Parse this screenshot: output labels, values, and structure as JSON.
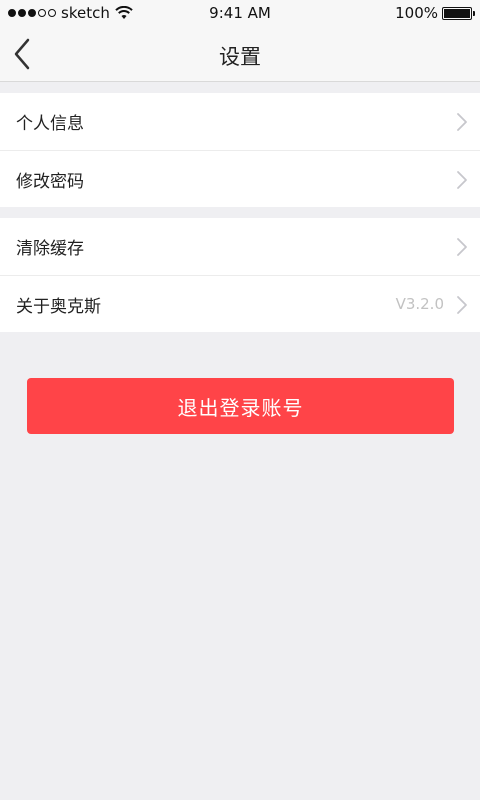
{
  "status_bar": {
    "carrier": "sketch",
    "time": "9:41 AM",
    "battery": "100%"
  },
  "nav": {
    "title": "设置",
    "back_icon": "chevron-left-icon"
  },
  "groups": [
    {
      "items": [
        {
          "label": "个人信息",
          "value": ""
        },
        {
          "label": "修改密码",
          "value": ""
        }
      ]
    },
    {
      "items": [
        {
          "label": "清除缓存",
          "value": ""
        },
        {
          "label": "关于奥克斯",
          "value": "V3.2.0"
        }
      ]
    }
  ],
  "logout": {
    "label": "退出登录账号",
    "color": "#ff4448"
  }
}
